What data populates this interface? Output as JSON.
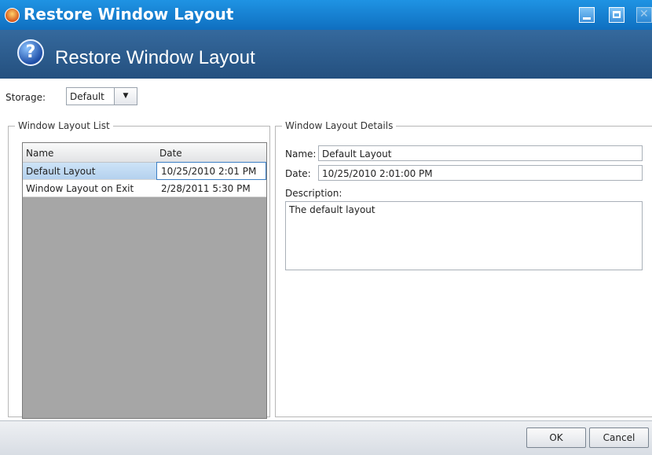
{
  "window": {
    "title": "Restore Window Layout"
  },
  "header": {
    "title": "Restore Window Layout",
    "icon": "help-icon"
  },
  "storage": {
    "label": "Storage:",
    "value": "Default"
  },
  "list": {
    "legend": "Window Layout List",
    "columns": [
      "Name",
      "Date"
    ],
    "rows": [
      {
        "name": "Default Layout",
        "date": "10/25/2010 2:01 PM"
      },
      {
        "name": "Window Layout on Exit",
        "date": "2/28/2011 5:30 PM"
      }
    ]
  },
  "details": {
    "legend": "Window Layout Details",
    "name_label": "Name:",
    "name_value": "Default Layout",
    "date_label": "Date:",
    "date_value": "10/25/2010 2:01:00 PM",
    "description_label": "Description:",
    "description_value": "The default layout"
  },
  "buttons": {
    "ok": "OK",
    "cancel": "Cancel"
  },
  "colors": {
    "titlebar": "#1a86d8",
    "header": "#2d5f93",
    "selection": "#c3dbf3"
  }
}
